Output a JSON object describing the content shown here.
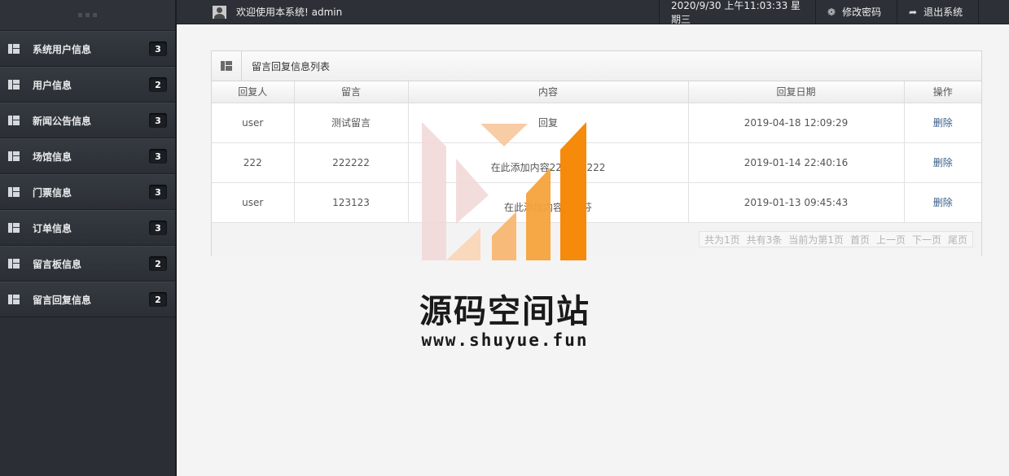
{
  "sidebar": {
    "items": [
      {
        "label": "系统用户信息",
        "count": "3"
      },
      {
        "label": "用户信息",
        "count": "2"
      },
      {
        "label": "新闻公告信息",
        "count": "3"
      },
      {
        "label": "场馆信息",
        "count": "3"
      },
      {
        "label": "门票信息",
        "count": "3"
      },
      {
        "label": "订单信息",
        "count": "3"
      },
      {
        "label": "留言板信息",
        "count": "2"
      },
      {
        "label": "留言回复信息",
        "count": "2"
      }
    ]
  },
  "header": {
    "welcome": "欢迎使用本系统! admin",
    "datetime": "2020/9/30 上午11:03:33 星期三",
    "change_password": "修改密码",
    "logout": "退出系统"
  },
  "panel": {
    "title": "留言回复信息列表",
    "columns": [
      "回复人",
      "留言",
      "内容",
      "回复日期",
      "操作"
    ],
    "rows": [
      {
        "replier": "user",
        "message": "测试留言",
        "content": "回复",
        "date": "2019-04-18 12:09:29",
        "action": "删除"
      },
      {
        "replier": "222",
        "message": "222222",
        "content": "在此添加内容222222222",
        "date": "2019-01-14 22:40:16",
        "action": "删除"
      },
      {
        "replier": "user",
        "message": "123123",
        "content": "在此添加内容斯蒂芬",
        "date": "2019-01-13 09:45:43",
        "action": "删除"
      }
    ],
    "pager": {
      "total_pages": "共为1页",
      "total_records": "共有3条",
      "current_page": "当前为第1页",
      "first": "首页",
      "prev": "上一页",
      "next": "下一页",
      "last": "尾页"
    }
  },
  "watermark": {
    "title": "源码空间站",
    "url": "www.shuyue.fun"
  },
  "colors": {
    "sidebar_bg": "#2b2f35",
    "header_bg": "#2d3137",
    "link": "#3a5f8a",
    "logo_orange": "#f58a0b",
    "logo_pink": "#f2d9d8"
  }
}
